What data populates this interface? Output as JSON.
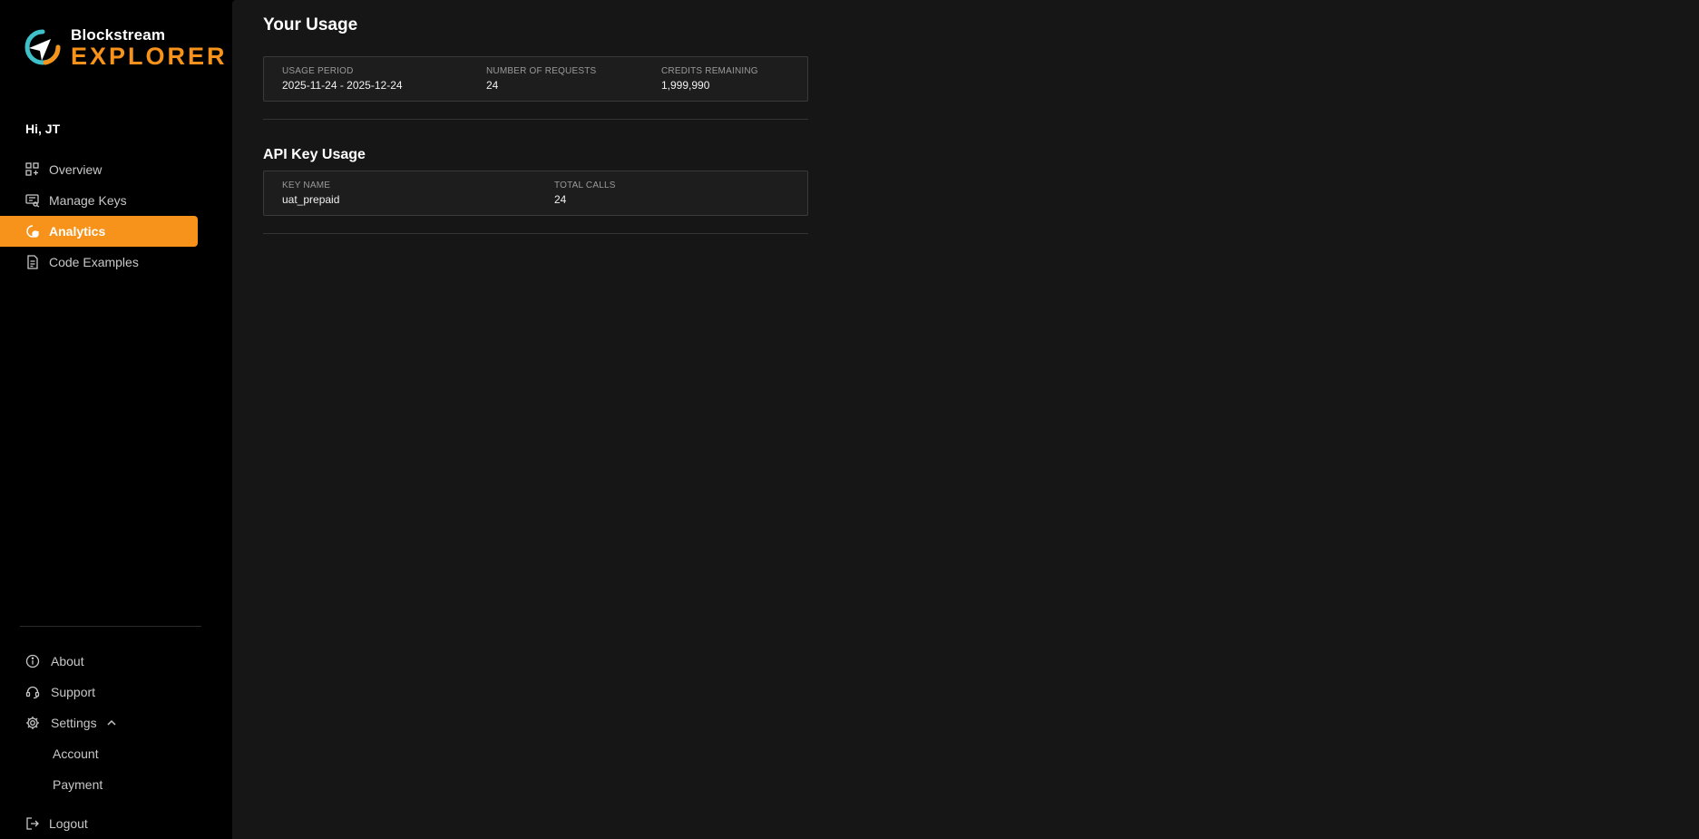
{
  "brand": {
    "name_top": "Blockstream",
    "name_bottom": "EXPLORER",
    "accent": "#f7931a",
    "teal": "#3fc1c9"
  },
  "sidebar": {
    "greeting": "Hi, JT",
    "items": [
      {
        "label": "Overview",
        "icon": "grid-plus-icon"
      },
      {
        "label": "Manage Keys",
        "icon": "key-list-icon"
      },
      {
        "label": "Analytics",
        "icon": "analytics-icon",
        "active": true
      },
      {
        "label": "Code Examples",
        "icon": "document-icon"
      }
    ],
    "bottom": {
      "about": "About",
      "support": "Support",
      "settings": "Settings",
      "account": "Account",
      "payment": "Payment",
      "logout": "Logout"
    }
  },
  "main": {
    "usage_title": "Your Usage",
    "usage": {
      "period_label": "USAGE PERIOD",
      "period_value": "2025-11-24 - 2025-12-24",
      "requests_label": "NUMBER OF REQUESTS",
      "requests_value": "24",
      "credits_label": "CREDITS REMAINING",
      "credits_value": "1,999,990"
    },
    "api_title": "API Key Usage",
    "api": {
      "key_label": "KEY NAME",
      "key_value": "uat_prepaid",
      "calls_label": "TOTAL CALLS",
      "calls_value": "24"
    }
  }
}
